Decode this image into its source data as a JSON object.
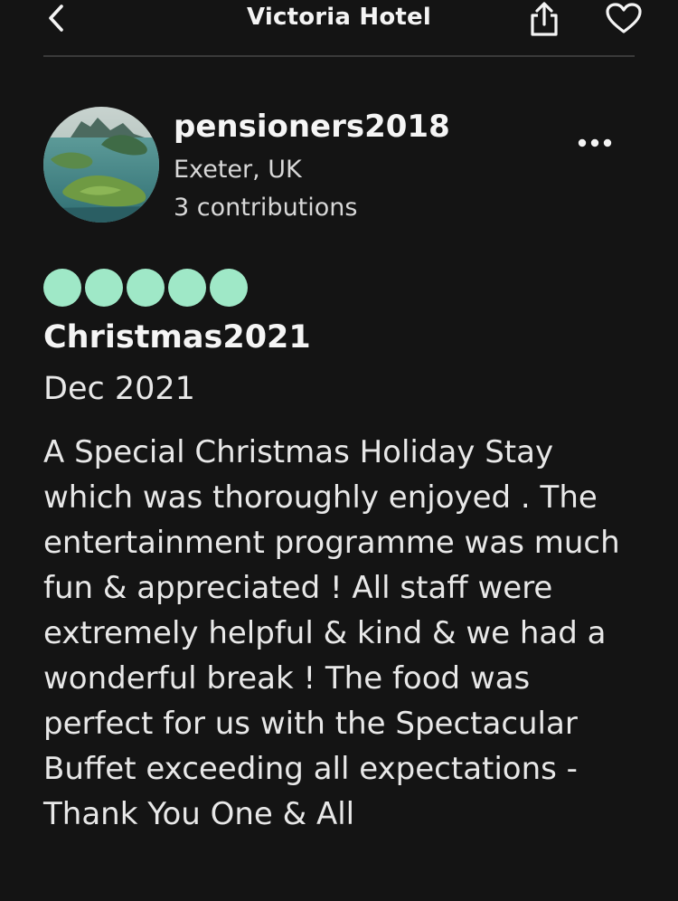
{
  "header": {
    "title": "Victoria Hotel",
    "back_icon": "chevron-left-icon",
    "share_icon": "share-icon",
    "save_icon": "heart-icon"
  },
  "reviewer": {
    "username": "pensioners2018",
    "location": "Exeter, UK",
    "contributions": "3 contributions",
    "avatar": "island-landscape-photo",
    "more_icon": "more-horizontal-icon"
  },
  "review": {
    "rating": 5,
    "rating_max": 5,
    "bubble_color": "#9fe8c7",
    "title": "Christmas2021",
    "date": "Dec 2021",
    "body": "A Special Christmas Holiday Stay which was thoroughly enjoyed . The entertainment programme was much fun & appreciated ! All staff were extremely helpful & kind & we had a wonderful break ! The food was perfect for us with the Spectacular Buffet exceeding all expectations - Thank You One & All"
  },
  "theme": {
    "background": "#141414",
    "text": "#f2f2f2",
    "accent": "#9fe8c7"
  }
}
